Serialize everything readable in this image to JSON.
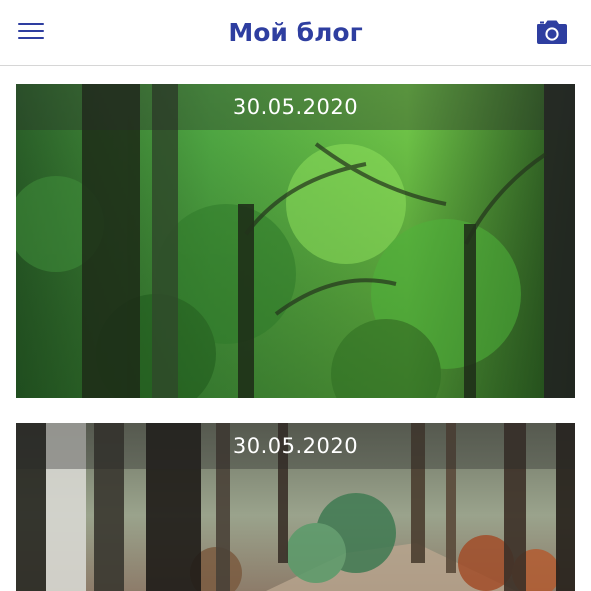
{
  "header": {
    "title": "Мой блог",
    "menu_icon": "hamburger-menu-icon",
    "camera_icon": "camera-icon",
    "accent_color": "#2e3ea0"
  },
  "posts": [
    {
      "date": "30.05.2020",
      "image": "green-forest-photo"
    },
    {
      "date": "30.05.2020",
      "image": "woodland-path-photo"
    }
  ]
}
